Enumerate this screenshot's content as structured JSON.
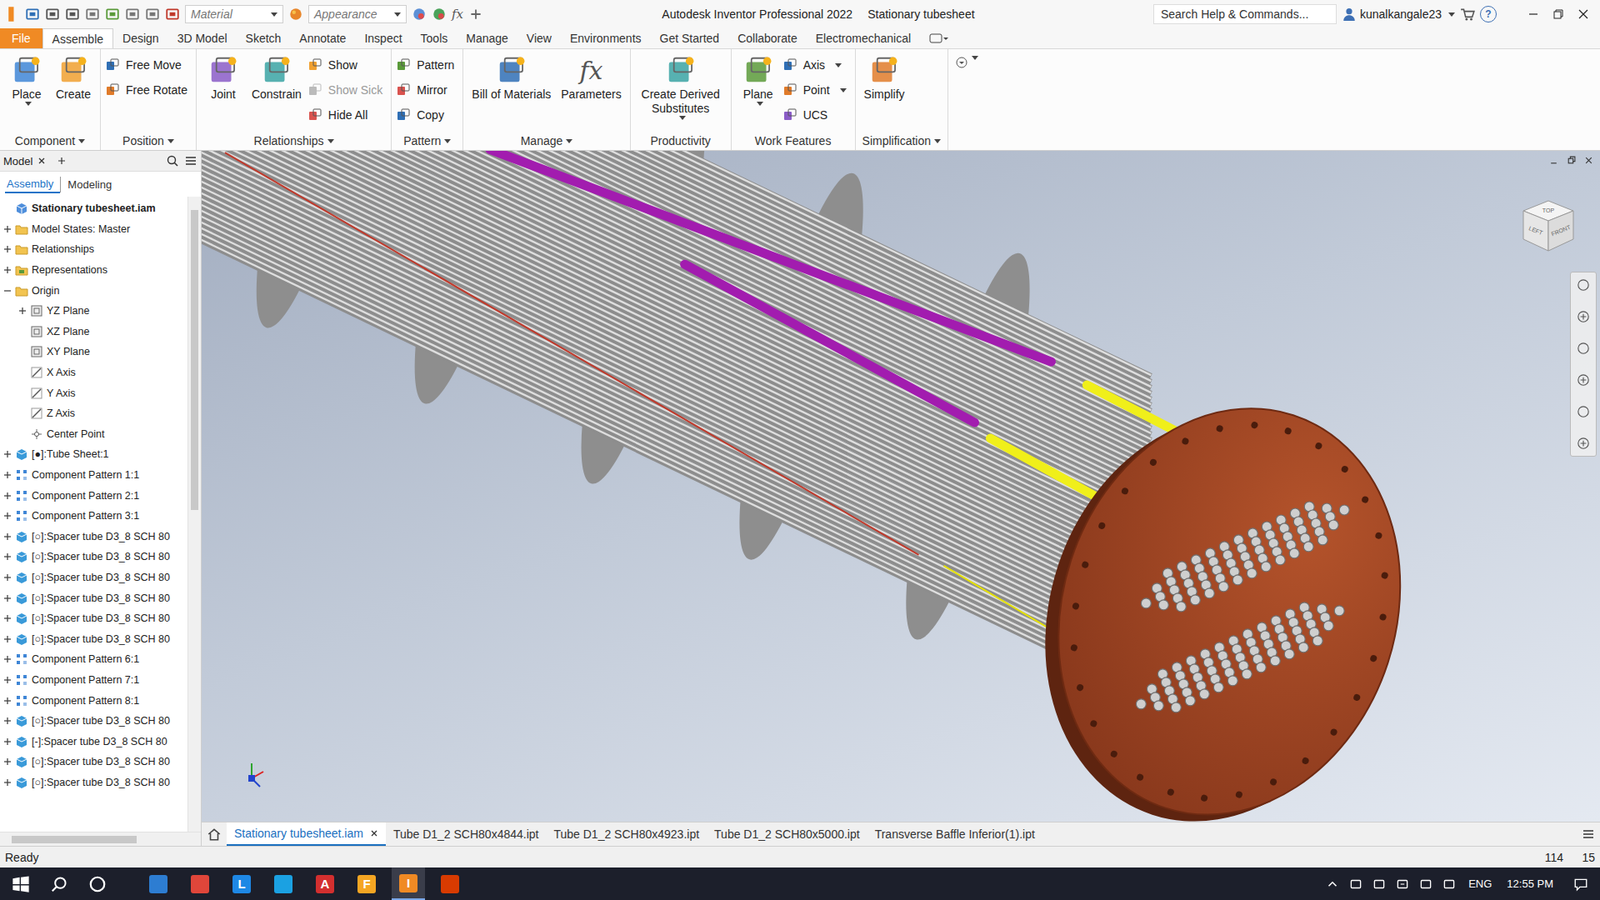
{
  "window": {
    "title": "Autodesk Inventor Professional 2022",
    "document": "Stationary tubesheet",
    "help": "?"
  },
  "quick_access": {
    "material": "Material",
    "appearance": "Appearance",
    "fx": "fx"
  },
  "search": {
    "placeholder": "Search Help & Commands..."
  },
  "user": {
    "name": "kunalkangale23"
  },
  "ribbon_tabs": [
    {
      "label": "File",
      "selected": false
    },
    {
      "label": "Assemble",
      "selected": true
    },
    {
      "label": "Design",
      "selected": false
    },
    {
      "label": "3D Model",
      "selected": false
    },
    {
      "label": "Sketch",
      "selected": false
    },
    {
      "label": "Annotate",
      "selected": false
    },
    {
      "label": "Inspect",
      "selected": false
    },
    {
      "label": "Tools",
      "selected": false
    },
    {
      "label": "Manage",
      "selected": false
    },
    {
      "label": "View",
      "selected": false
    },
    {
      "label": "Environments",
      "selected": false
    },
    {
      "label": "Get Started",
      "selected": false
    },
    {
      "label": "Collaborate",
      "selected": false
    },
    {
      "label": "Electromechanical",
      "selected": false
    }
  ],
  "ribbon_panels": [
    {
      "label": "Component",
      "dropdown": true,
      "groups": [
        {
          "kind": "large",
          "label": "Place",
          "dropdown": true,
          "glyph": ""
        },
        {
          "kind": "large",
          "label": "Create",
          "dropdown": false,
          "glyph": ""
        }
      ]
    },
    {
      "label": "Position",
      "dropdown": true,
      "groups": [
        {
          "kind": "stack",
          "buttons": [
            {
              "label": "Free Move",
              "disabled": false,
              "dropdown": false
            },
            {
              "label": "Free Rotate",
              "disabled": false,
              "dropdown": false
            }
          ]
        }
      ]
    },
    {
      "label": "Relationships",
      "dropdown": true,
      "groups": [
        {
          "kind": "large",
          "label": "Joint",
          "dropdown": false,
          "glyph": ""
        },
        {
          "kind": "large",
          "label": "Constrain",
          "dropdown": false,
          "glyph": ""
        },
        {
          "kind": "stack",
          "buttons": [
            {
              "label": "Show",
              "disabled": false,
              "dropdown": false
            },
            {
              "label": "Show Sick",
              "disabled": true,
              "dropdown": false
            },
            {
              "label": "Hide All",
              "disabled": false,
              "dropdown": false
            }
          ]
        }
      ]
    },
    {
      "label": "Pattern",
      "dropdown": true,
      "groups": [
        {
          "kind": "stack",
          "buttons": [
            {
              "label": "Pattern",
              "disabled": false,
              "dropdown": false
            },
            {
              "label": "Mirror",
              "disabled": false,
              "dropdown": false
            },
            {
              "label": "Copy",
              "disabled": false,
              "dropdown": false
            }
          ]
        }
      ]
    },
    {
      "label": "Manage",
      "dropdown": true,
      "groups": [
        {
          "kind": "large",
          "label": "Bill of Materials",
          "dropdown": false,
          "glyph": ""
        },
        {
          "kind": "large",
          "label": "Parameters",
          "dropdown": false,
          "glyph": "fx"
        }
      ]
    },
    {
      "label": "Productivity",
      "dropdown": false,
      "groups": [
        {
          "kind": "large",
          "label": "Create Derived Substitutes",
          "dropdown": true,
          "glyph": ""
        }
      ]
    },
    {
      "label": "Work Features",
      "dropdown": false,
      "groups": [
        {
          "kind": "large",
          "label": "Plane",
          "dropdown": true,
          "glyph": ""
        },
        {
          "kind": "stack",
          "buttons": [
            {
              "label": "Axis",
              "disabled": false,
              "dropdown": true
            },
            {
              "label": "Point",
              "disabled": false,
              "dropdown": true
            },
            {
              "label": "UCS",
              "disabled": false,
              "dropdown": false
            }
          ]
        }
      ]
    },
    {
      "label": "Simplification",
      "dropdown": true,
      "groups": [
        {
          "kind": "large",
          "label": "Simplify",
          "dropdown": false,
          "glyph": ""
        }
      ]
    }
  ],
  "browser": {
    "tab": "Model",
    "subtabs": [
      {
        "label": "Assembly",
        "selected": true
      },
      {
        "label": "Modeling",
        "selected": false
      }
    ]
  },
  "tree": [
    {
      "label": "Stationary tubesheet.iam",
      "indent": 0,
      "expanded": null,
      "kind": "assembly",
      "bold": true
    },
    {
      "label": "Model States: Master",
      "indent": 0,
      "expanded": false,
      "kind": "folder",
      "bold": false
    },
    {
      "label": "Relationships",
      "indent": 0,
      "expanded": false,
      "kind": "folder",
      "bold": false
    },
    {
      "label": "Representations",
      "indent": 0,
      "expanded": false,
      "kind": "representations",
      "bold": false
    },
    {
      "label": "Origin",
      "indent": 0,
      "expanded": true,
      "kind": "folder",
      "bold": false
    },
    {
      "label": "YZ Plane",
      "indent": 1,
      "expanded": false,
      "kind": "plane",
      "bold": false
    },
    {
      "label": "XZ Plane",
      "indent": 1,
      "expanded": null,
      "kind": "plane",
      "bold": false
    },
    {
      "label": "XY Plane",
      "indent": 1,
      "expanded": null,
      "kind": "plane",
      "bold": false
    },
    {
      "label": "X Axis",
      "indent": 1,
      "expanded": null,
      "kind": "axis",
      "bold": false
    },
    {
      "label": "Y Axis",
      "indent": 1,
      "expanded": null,
      "kind": "axis",
      "bold": false
    },
    {
      "label": "Z Axis",
      "indent": 1,
      "expanded": null,
      "kind": "axis",
      "bold": false
    },
    {
      "label": "Center Point",
      "indent": 1,
      "expanded": null,
      "kind": "point",
      "bold": false
    },
    {
      "label": "[●]:Tube Sheet:1",
      "indent": 0,
      "expanded": false,
      "kind": "part",
      "bold": false
    },
    {
      "label": "Component Pattern 1:1",
      "indent": 0,
      "expanded": false,
      "kind": "pattern",
      "bold": false
    },
    {
      "label": "Component Pattern 2:1",
      "indent": 0,
      "expanded": false,
      "kind": "pattern",
      "bold": false
    },
    {
      "label": "Component Pattern 3:1",
      "indent": 0,
      "expanded": false,
      "kind": "pattern",
      "bold": false
    },
    {
      "label": "[○]:Spacer tube D3_8 SCH 80",
      "indent": 0,
      "expanded": false,
      "kind": "part",
      "bold": false
    },
    {
      "label": "[○]:Spacer tube D3_8 SCH 80",
      "indent": 0,
      "expanded": false,
      "kind": "part",
      "bold": false
    },
    {
      "label": "[○]:Spacer tube D3_8 SCH 80",
      "indent": 0,
      "expanded": false,
      "kind": "part",
      "bold": false
    },
    {
      "label": "[○]:Spacer tube D3_8 SCH 80",
      "indent": 0,
      "expanded": false,
      "kind": "part",
      "bold": false
    },
    {
      "label": "[○]:Spacer tube D3_8 SCH 80",
      "indent": 0,
      "expanded": false,
      "kind": "part",
      "bold": false
    },
    {
      "label": "[○]:Spacer tube D3_8 SCH 80",
      "indent": 0,
      "expanded": false,
      "kind": "part",
      "bold": false
    },
    {
      "label": "Component Pattern 6:1",
      "indent": 0,
      "expanded": false,
      "kind": "pattern",
      "bold": false
    },
    {
      "label": "Component Pattern 7:1",
      "indent": 0,
      "expanded": false,
      "kind": "pattern",
      "bold": false
    },
    {
      "label": "Component Pattern 8:1",
      "indent": 0,
      "expanded": false,
      "kind": "pattern",
      "bold": false
    },
    {
      "label": "[○]:Spacer tube D3_8 SCH 80",
      "indent": 0,
      "expanded": false,
      "kind": "part",
      "bold": false
    },
    {
      "label": "[-]:Spacer tube D3_8 SCH 80",
      "indent": 0,
      "expanded": false,
      "kind": "part",
      "bold": false
    },
    {
      "label": "[○]:Spacer tube D3_8 SCH 80",
      "indent": 0,
      "expanded": false,
      "kind": "part",
      "bold": false
    },
    {
      "label": "[○]:Spacer tube D3_8 SCH 80",
      "indent": 0,
      "expanded": false,
      "kind": "part",
      "bold": false
    }
  ],
  "viewcube": {
    "top": "TOP",
    "left": "LEFT",
    "front": "FRONT"
  },
  "document_tabs": [
    {
      "label": "Stationary tubesheet.iam",
      "selected": true
    },
    {
      "label": "Tube D1_2 SCH80x4844.ipt",
      "selected": false
    },
    {
      "label": "Tube D1_2 SCH80x4923.ipt",
      "selected": false
    },
    {
      "label": "Tube D1_2 SCH80x5000.ipt",
      "selected": false
    },
    {
      "label": "Transverse Baffle Inferior(1).ipt",
      "selected": false
    }
  ],
  "status_bar": {
    "text": "Ready",
    "counts": [
      "114",
      "15"
    ]
  },
  "taskbar": {
    "apps": [
      {
        "glyph": "",
        "color": "#2d7dd2",
        "active": false
      },
      {
        "glyph": "",
        "color": "#e0463a",
        "active": false
      },
      {
        "glyph": "L",
        "color": "#1e88e5",
        "active": false
      },
      {
        "glyph": "",
        "color": "#1ba1e2",
        "active": false
      },
      {
        "glyph": "A",
        "color": "#d32f2f",
        "active": false
      },
      {
        "glyph": "F",
        "color": "#f5a623",
        "active": false
      },
      {
        "glyph": "I",
        "color": "#f08a24",
        "active": true
      },
      {
        "glyph": "",
        "color": "#d83b01",
        "active": false
      }
    ],
    "language": "ENG",
    "time": "12:55 PM"
  }
}
